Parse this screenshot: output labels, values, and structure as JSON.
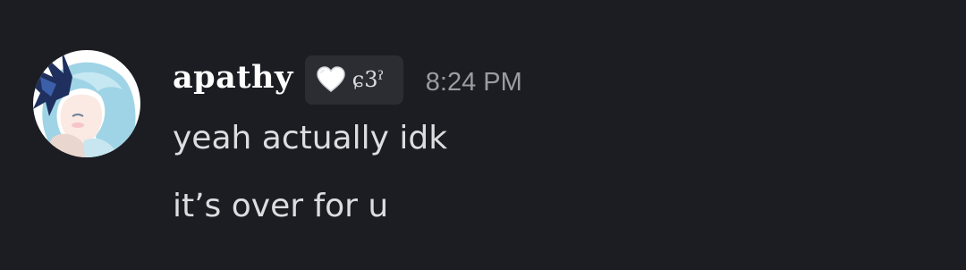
{
  "message": {
    "author": {
      "username": "apathy",
      "avatar_icon": "anime-avatar",
      "server_tag": {
        "icon": "white-heart-icon",
        "text": "ɕ3ˀ"
      }
    },
    "timestamp": "8:24 PM",
    "lines": [
      "yeah actually idk",
      "it’s over for u"
    ]
  },
  "colors": {
    "background": "#1c1d22",
    "text": "#dbdee1",
    "username": "#ffffff",
    "timestamp": "#9b9ca3",
    "tag_background": "#2b2d33"
  }
}
